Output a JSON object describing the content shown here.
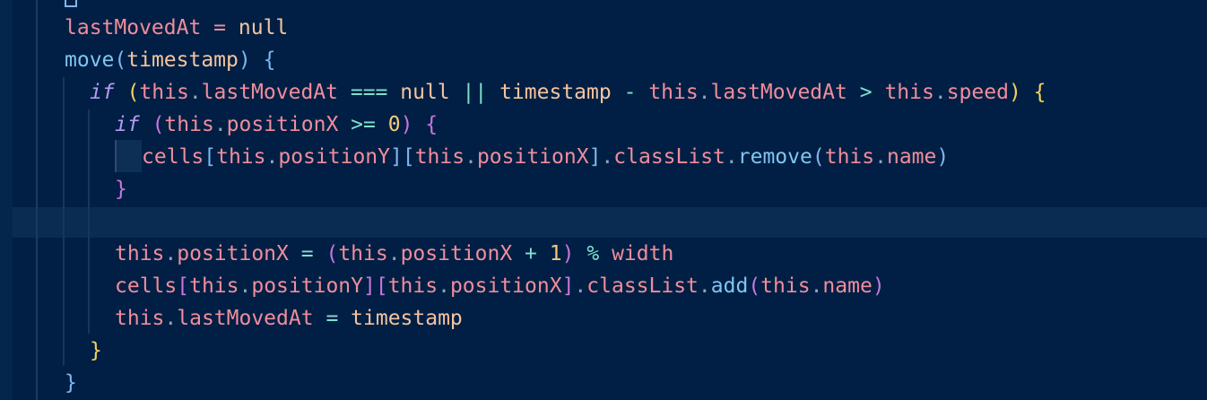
{
  "code": {
    "lines": [
      "lastMovedAt = null",
      "move(timestamp) {",
      "if (this.lastMovedAt === null || timestamp - this.lastMovedAt > this.speed) {",
      "if (this.positionX >= 0) {",
      "cells[this.positionY][this.positionX].classList.remove(this.name)",
      "}",
      "",
      "this.positionX = (this.positionX + 1) % width",
      "cells[this.positionY][this.positionX].classList.add(this.name)",
      "this.lastMovedAt = timestamp",
      "}",
      "}"
    ]
  },
  "tokens": {
    "null": "null",
    "if": "if",
    "this": "this",
    "width": "width",
    "timestamp": "timestamp",
    "zero": "0",
    "one": "1"
  }
}
